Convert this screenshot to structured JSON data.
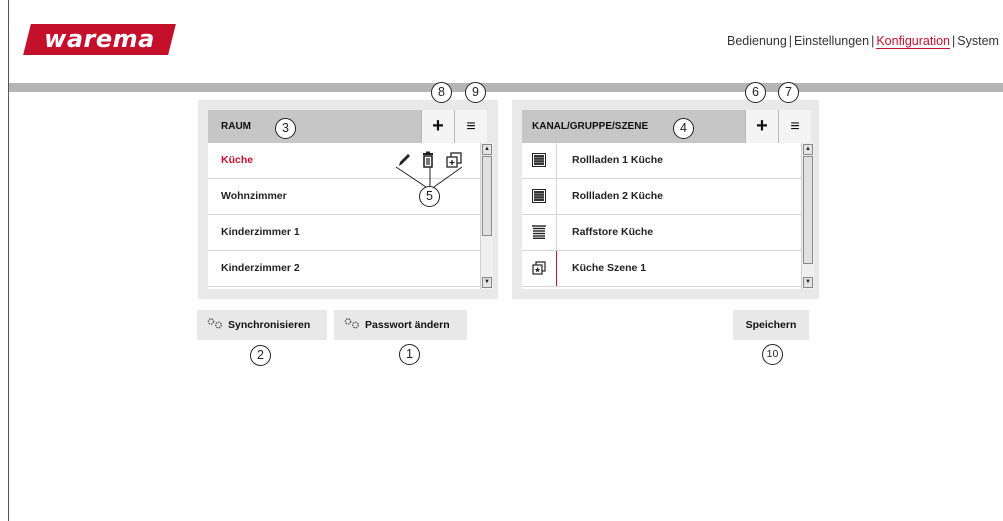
{
  "brand": {
    "logo_text": "warema",
    "accent": "#c5102b"
  },
  "topnav": {
    "items": [
      "Bedienung",
      "Einstellungen",
      "Konfiguration",
      "System"
    ],
    "separator": "|",
    "active_index": 2
  },
  "room_panel": {
    "title": "RAUM",
    "add_label": "+",
    "menu_label": "≡",
    "rows": [
      "Küche",
      "Wohnzimmer",
      "Kinderzimmer 1",
      "Kinderzimmer 2"
    ],
    "selected_row": "Küche",
    "row_actions": [
      "edit-icon",
      "trash-icon",
      "copy-icon"
    ]
  },
  "channel_panel": {
    "title": "KANAL/GRUPPE/SZENE",
    "add_label": "+",
    "menu_label": "≡",
    "rows": [
      {
        "label": "Rollladen 1 Küche",
        "icon": "shutter-icon"
      },
      {
        "label": "Rollladen 2 Küche",
        "icon": "shutter-icon"
      },
      {
        "label": "Raffstore Küche",
        "icon": "venetian-blind-icon"
      },
      {
        "label": "Küche Szene 1",
        "icon": "scene-icon"
      }
    ]
  },
  "buttons": {
    "sync": "Synchronisieren",
    "password": "Passwort ändern",
    "save": "Speichern"
  },
  "callouts": {
    "c1": "1",
    "c2": "2",
    "c3": "3",
    "c4": "4",
    "c5": "5",
    "c6": "6",
    "c7": "7",
    "c8": "8",
    "c9": "9",
    "c10": "10"
  }
}
